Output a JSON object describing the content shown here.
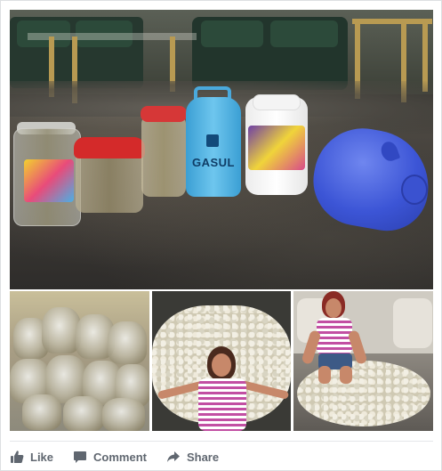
{
  "post": {
    "main_photo": {
      "gas_cylinder_text": "GASUL"
    }
  },
  "actions": {
    "like_label": "Like",
    "comment_label": "Comment",
    "share_label": "Share",
    "like_icon": "thumbs-up-icon",
    "comment_icon": "speech-bubble-icon",
    "share_icon": "share-arrow-icon"
  },
  "colors": {
    "action_text": "#606770",
    "divider": "#e5e6ea",
    "background": "#ffffff"
  }
}
